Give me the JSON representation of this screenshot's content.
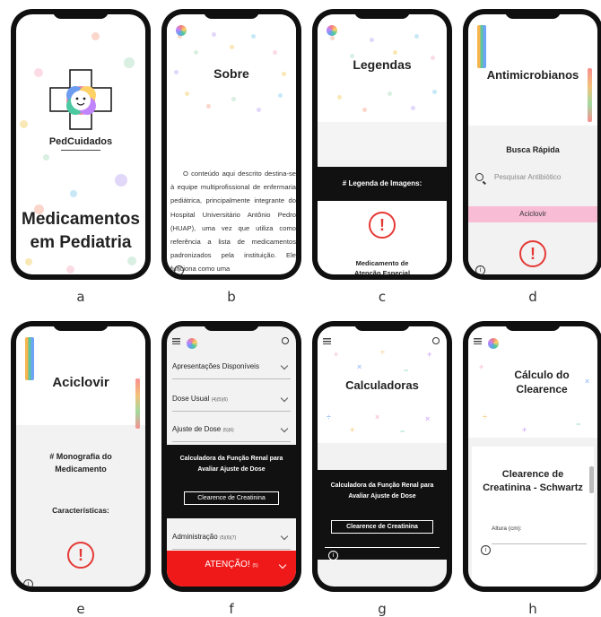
{
  "screens": {
    "a": {
      "brand": "PedCuidados",
      "title_line1": "Medicamentos",
      "title_line2": "em Pediatria",
      "caption": "a"
    },
    "b": {
      "title": "Sobre",
      "body": "O conteúdo aqui descrito destina-se à equipe multiprofissional de enfermaria pediátrica, principalmente integrante do Hospital Universitário Antônio Pedro (HUAP), uma vez que utiliza como referência a lista de medicamentos padronizados pela instituição. Ele funciona como uma",
      "caption": "b"
    },
    "c": {
      "title": "Legendas",
      "bar_text": "# Legenda de Imagens:",
      "warn_label": "Medicamento de Atenção Especial",
      "caption": "c"
    },
    "d": {
      "title": "Antimicrobianos",
      "subtitle": "Busca Rápida",
      "search_placeholder": "Pesquisar Antibiótico",
      "result": "Aciclovir",
      "caption": "d"
    },
    "e": {
      "title": "Aciclovir",
      "heading": "# Monografia do Medicamento",
      "subheading": "Características:",
      "caption": "e"
    },
    "f": {
      "items": [
        "Apresentações Disponíveis",
        "Dose Usual",
        "Ajuste de Dose"
      ],
      "item_refs": [
        "",
        "(4)(5)(6)",
        "(5)(6)"
      ],
      "calc_title": "Calculadora da Função Renal para Avaliar Ajuste de Dose",
      "calc_button": "Clearence de Creatinina",
      "admin": "Administração",
      "admin_ref": "(5)(6)(7)",
      "alert": "ATENÇÃO!",
      "alert_ref": "(5)",
      "caption": "f"
    },
    "g": {
      "title": "Calculadoras",
      "calc_title": "Calculadora da Função Renal para Avaliar Ajuste de Dose",
      "calc_button": "Clearence de Creatinina",
      "caption": "g"
    },
    "h": {
      "title": "Cálculo do Clearence",
      "heading": "Clearence de Creatinina - Schwartz",
      "field_label": "Altura (cm):",
      "caption": "h"
    }
  },
  "colors": {
    "accent_red": "#e53935",
    "pink": "#f8bcd4",
    "dark": "#111111"
  },
  "icons": [
    "plus-cross-logo",
    "baby-face-icon",
    "warning-icon",
    "info-icon",
    "search-icon",
    "hamburger-icon",
    "chevron-down-icon"
  ]
}
